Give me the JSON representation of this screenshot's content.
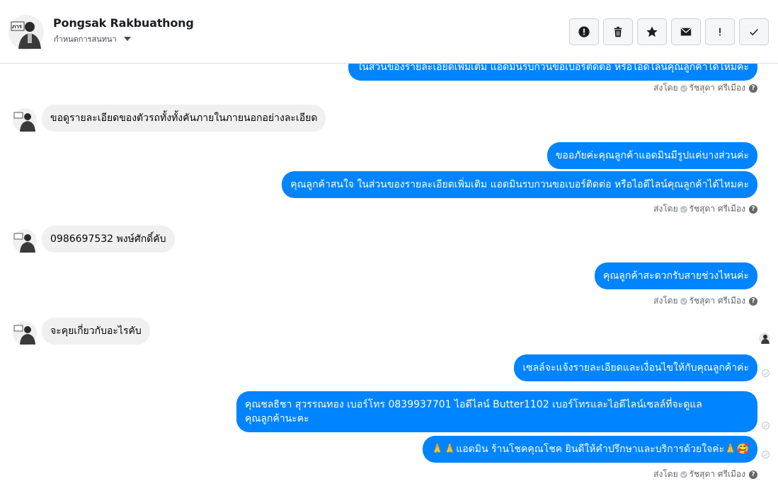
{
  "header": {
    "name": "Pongsak Rakbuathong",
    "assign_label": "กำหนดการสนทนา",
    "actions": [
      {
        "name": "mark-spam-button",
        "icon": "alert-circle-icon"
      },
      {
        "name": "delete-button",
        "icon": "trash-icon"
      },
      {
        "name": "star-button",
        "icon": "star-icon"
      },
      {
        "name": "mark-unread-button",
        "icon": "envelope-icon"
      },
      {
        "name": "follow-up-button",
        "icon": "exclamation-icon"
      },
      {
        "name": "mark-done-button",
        "icon": "check-icon"
      }
    ]
  },
  "messages": {
    "m0": "ในส่วนของรายละเอียดเพิ่มเติม แอดมินรบกวนขอเบอร์ติดต่อ หรือไอดีไลน์คุณลูกค้าได้ไหมคะ",
    "m1": "ขอดูรายละเอียดของตัวรถทั้งทั้งคันภายในภายนอกอย่างละเอียด",
    "m2": "ขออภัยค่ะคุณลูกค้าแอดมินมีรูปแค่บางส่วนค่ะ",
    "m3": "คุณลูกค้าสนใจ ในส่วนของรายละเอียดเพิ่มเติม แอดมินรบกวนขอเบอร์ติดต่อ หรือไอดีไลน์คุณลูกค้าได้ไหมคะ",
    "m4": "0986697532 พงษ์ศักดิ์คับ",
    "m5": "คุณลูกค้าสะดวกรับสายช่วงไหนค่ะ",
    "m6": "จะคุยเกี่ยวกับอะไรคับ",
    "m7": "เซลล์จะแจ้งรายละเอียดและเงื่อนไขให้กับคุณลูกค้าค่ะ",
    "m8_line1": "คุณชลธิชา สุวรรณทอง   เบอร์โทร 0839937701  ไอดีไลน์ Butter1102   เบอร์โทรและไอดีไลน์เซลล์ที่จะดูแล",
    "m8_line2": "คุณลูกค้านะคะ",
    "m9": "🙏🙏แอดมิน ร้านโชคคุณโชค ยินดีให้คำปรึกษาและบริการด้วยใจค่ะ🙏🥰"
  },
  "sent_by": {
    "prefix": "ส่งโดย",
    "agent": "รัชสุดา ศรีเมือง",
    "help": "?"
  },
  "colors": {
    "outgoing": "#0084ff",
    "incoming": "#f1f0f0"
  }
}
